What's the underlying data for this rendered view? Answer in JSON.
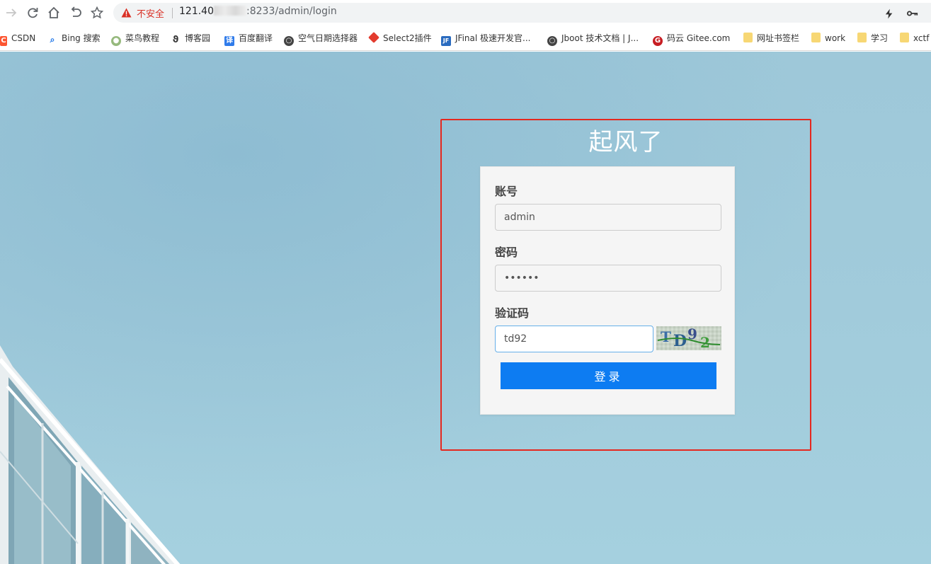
{
  "browser": {
    "security_label": "不安全",
    "url_host": "121.40",
    "url_path": ":8233/admin/login"
  },
  "bookmarks": [
    {
      "label": "CSDN",
      "icon": "csdn-icon",
      "color": "#fc5531"
    },
    {
      "label": "Bing 搜索",
      "icon": "search-icon",
      "color": "#1a73e8"
    },
    {
      "label": "菜鸟教程",
      "icon": "runoob-icon",
      "color": "#96b97d"
    },
    {
      "label": "博客园",
      "icon": "cnblogs-icon",
      "color": "#333333"
    },
    {
      "label": "百度翻译",
      "icon": "translate-icon",
      "color": "#2f7bea"
    },
    {
      "label": "空气日期选择器",
      "icon": "globe-icon",
      "color": "#444444"
    },
    {
      "label": "Select2插件",
      "icon": "select2-icon",
      "color": "#e33b2e"
    },
    {
      "label": "JFinal 极速开发官...",
      "icon": "jfinal-icon",
      "color": "#2a6bbf"
    },
    {
      "label": "Jboot 技术文档 | J...",
      "icon": "globe-icon",
      "color": "#444444"
    },
    {
      "label": "码云 Gitee.com",
      "icon": "gitee-icon",
      "color": "#c71d23"
    },
    {
      "label": "网址书签栏",
      "icon": "folder-icon",
      "color": "#f7d774"
    },
    {
      "label": "work",
      "icon": "folder-icon",
      "color": "#f7d774"
    },
    {
      "label": "学习",
      "icon": "folder-icon",
      "color": "#f7d774"
    },
    {
      "label": "xctf",
      "icon": "folder-icon",
      "color": "#f7d774"
    }
  ],
  "login": {
    "title": "起风了",
    "account_label": "账号",
    "account_value": "admin",
    "password_label": "密码",
    "password_value": "123456",
    "captcha_label": "验证码",
    "captcha_value": "td92",
    "captcha_image_text": "TD92",
    "submit_label": "登录",
    "accent_color": "#0d7cf2",
    "highlight_color": "#e5281f"
  }
}
